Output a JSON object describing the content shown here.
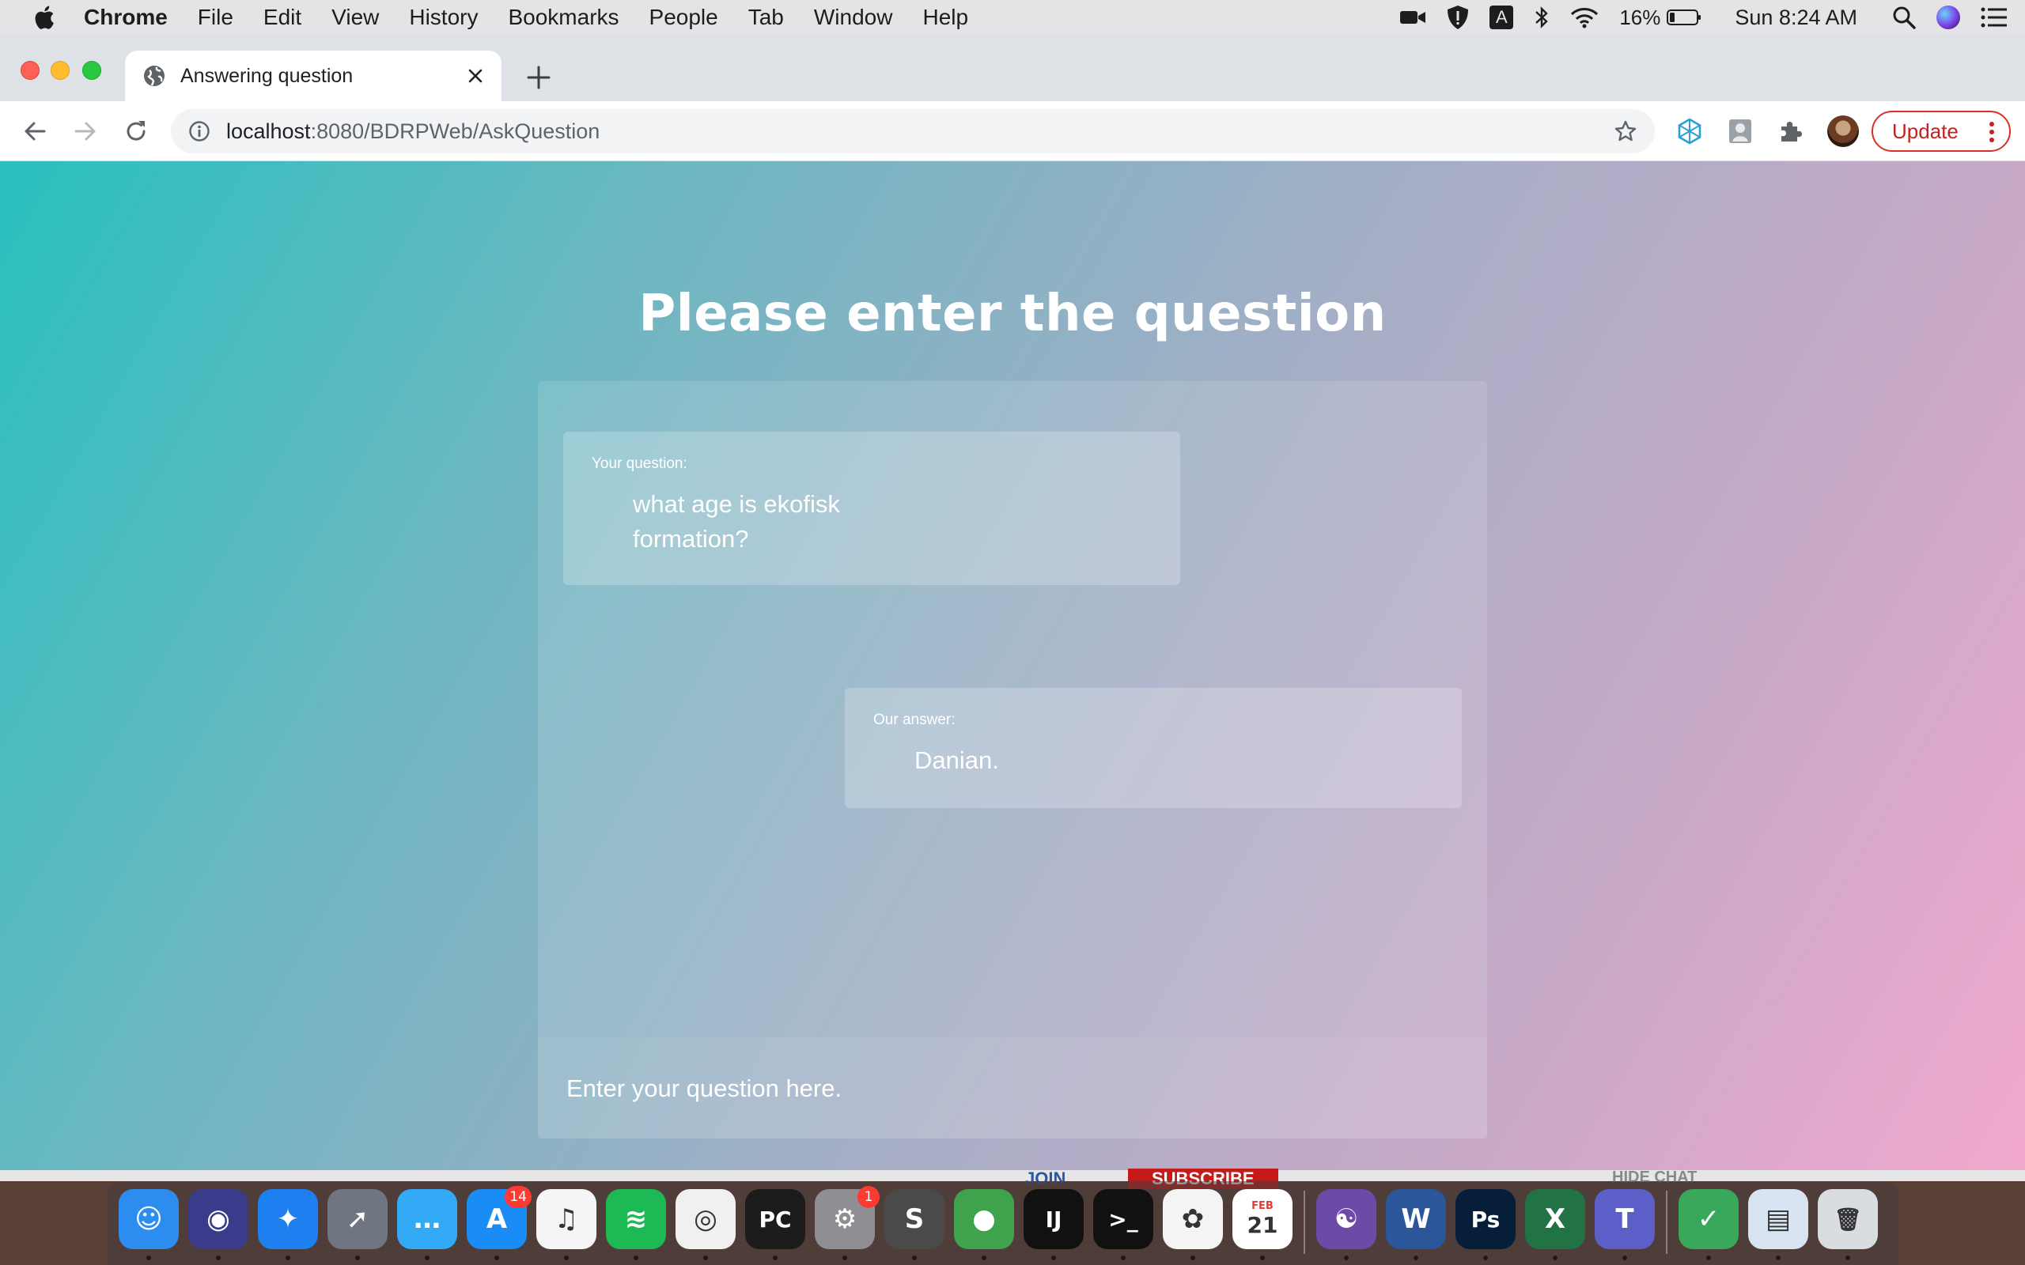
{
  "menubar": {
    "app_name": "Chrome",
    "items": [
      "File",
      "Edit",
      "View",
      "History",
      "Bookmarks",
      "People",
      "Tab",
      "Window",
      "Help"
    ],
    "battery_percent": "16%",
    "clock": "Sun 8:24 AM",
    "input_source": "A"
  },
  "browser": {
    "tab": {
      "title": "Answering question"
    },
    "url": {
      "host": "localhost",
      "path": ":8080/BDRPWeb/AskQuestion"
    },
    "update_label": "Update"
  },
  "page": {
    "title": "Please enter the question",
    "question": {
      "label": "Your question:",
      "text": "what age is ekofisk formation?"
    },
    "answer": {
      "label": "Our answer:",
      "text": "Danian."
    },
    "input": {
      "placeholder": "Enter your question here.",
      "value": ""
    }
  },
  "background_window": {
    "join_label": "JOIN",
    "subscribe_label": "SUBSCRIBE",
    "hide_chat_label": "HIDE CHAT"
  },
  "dock": {
    "apps": [
      {
        "name": "Finder",
        "color": "#2d8cf0",
        "glyph": "☺"
      },
      {
        "name": "Siri",
        "color": "#3b3b8c",
        "glyph": "◉"
      },
      {
        "name": "Safari",
        "color": "#1e7ff0",
        "glyph": "✦"
      },
      {
        "name": "Launchpad",
        "color": "#6f7682",
        "glyph": "➚"
      },
      {
        "name": "Messages",
        "color": "#32aaf5",
        "glyph": "…"
      },
      {
        "name": "App Store",
        "color": "#1a8cf5",
        "glyph": "A",
        "badge": "14"
      },
      {
        "name": "Music",
        "color": "#f5f5f7",
        "glyph": "♫"
      },
      {
        "name": "Spotify",
        "color": "#1db954",
        "glyph": "≋"
      },
      {
        "name": "Chrome",
        "color": "#f0f0f0",
        "glyph": "◎"
      },
      {
        "name": "PyCharm",
        "color": "#1c1c1c",
        "glyph": "PC"
      },
      {
        "name": "System Preferences",
        "color": "#8e8e93",
        "glyph": "⚙",
        "badge": "1"
      },
      {
        "name": "Sublime Text",
        "color": "#4a4a4a",
        "glyph": "S"
      },
      {
        "name": "Neo4j",
        "color": "#3fa34d",
        "glyph": "●"
      },
      {
        "name": "IntelliJ IDEA",
        "color": "#111111",
        "glyph": "IJ"
      },
      {
        "name": "Terminal",
        "color": "#111111",
        "glyph": ">_"
      },
      {
        "name": "Affinity",
        "color": "#f4f4f4",
        "glyph": "✿"
      },
      {
        "name": "Calendar",
        "color": "#ffffff",
        "glyph": "21",
        "month": "FEB"
      },
      {
        "name": "GitHub Desktop",
        "color": "#6e4aa8",
        "glyph": "☯"
      },
      {
        "name": "Word",
        "color": "#2b579a",
        "glyph": "W"
      },
      {
        "name": "Photoshop",
        "color": "#061e3a",
        "glyph": "Ps"
      },
      {
        "name": "Excel",
        "color": "#217346",
        "glyph": "X"
      },
      {
        "name": "Teams",
        "color": "#5b5fc7",
        "glyph": "T"
      },
      {
        "name": "Security",
        "color": "#3aa85b",
        "glyph": "✓"
      },
      {
        "name": "Preview",
        "color": "#d8e4f2",
        "glyph": "▤"
      },
      {
        "name": "Trash",
        "color": "#d9dde2",
        "glyph": "🗑"
      }
    ]
  }
}
